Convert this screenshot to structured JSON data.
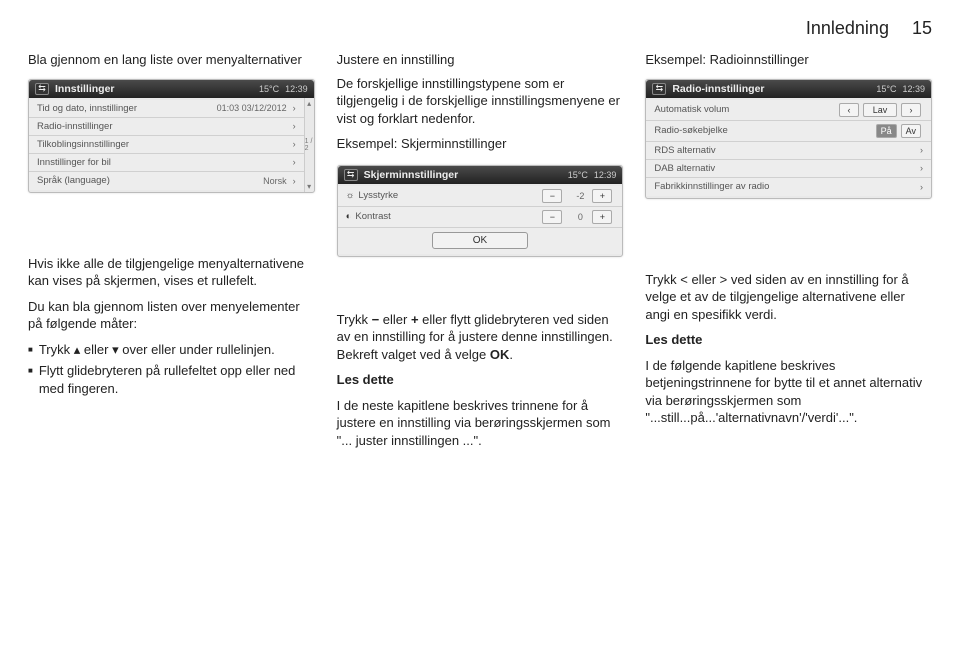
{
  "header": {
    "chapter": "Innledning",
    "page": "15"
  },
  "col1": {
    "heading": "Bla gjennom en lang liste over menyalternativer",
    "device": {
      "back": "⇆",
      "title": "Innstillinger",
      "temp": "15°C",
      "time": "12:39",
      "page_ind": "1 / 2",
      "rows": [
        {
          "label": "Tid og dato, innstillinger",
          "val": "01:03  03/12/2012",
          "chev": "›"
        },
        {
          "label": "Radio-innstillinger",
          "chev": "›"
        },
        {
          "label": "Tilkoblingsinnstillinger",
          "chev": "›"
        },
        {
          "label": "Innstillinger for bil",
          "chev": "›"
        },
        {
          "label": "Språk (language)",
          "val": "Norsk",
          "chev": "›"
        }
      ],
      "scroll_up": "▴",
      "scroll_dn": "▾"
    },
    "p1": "Hvis ikke alle de tilgjengelige menyalternativene kan vises på skjermen, vises et rullefelt.",
    "p2": "Du kan bla gjennom listen over menyelementer på følgende måter:",
    "b1_a": "Trykk ",
    "b1_up": "▴",
    "b1_mid": " eller ",
    "b1_dn": "▾",
    "b1_b": " over eller under rullelinjen.",
    "b2": "Flytt glidebryteren på rullefeltet opp eller ned med fingeren."
  },
  "col2": {
    "heading": "Justere en innstilling",
    "p1": "De forskjellige innstillingstypene som er tilgjengelig i de forskjellige innstillingsmenyene er vist og forklart nedenfor.",
    "p2": "Eksempel: Skjerminnstillinger",
    "device": {
      "back": "⇆",
      "title": "Skjerminnstillinger",
      "temp": "15°C",
      "time": "12:39",
      "row1": {
        "icon": "☼",
        "label": "Lysstyrke",
        "minus": "−",
        "val": "-2",
        "plus": "+"
      },
      "row2": {
        "icon": "◐",
        "label": "Kontrast",
        "minus": "−",
        "val": "0",
        "plus": "+"
      },
      "ok": "OK"
    },
    "p3a": "Trykk ",
    "p3minus": "−",
    "p3b": " eller ",
    "p3plus": "+",
    "p3c": " eller flytt glidebryteren ved siden av en innstilling for å justere denne innstillingen. Bekreft valget ved å velge ",
    "p3ok": "OK",
    "p3d": ".",
    "les": "Les dette",
    "p4": "I de neste kapitlene beskrives trinnene for å justere en innstilling via berøringsskjermen som \"... juster innstillingen ...\"."
  },
  "col3": {
    "heading": "Eksempel: Radioinnstillinger",
    "device": {
      "back": "⇆",
      "title": "Radio-innstillinger",
      "temp": "15°C",
      "time": "12:39",
      "rows": [
        {
          "label": "Automatisk volum",
          "left": "‹",
          "val": "Lav",
          "right": "›"
        },
        {
          "label": "Radio-søkebjelke",
          "on": "På",
          "off": "Av"
        },
        {
          "label": "RDS alternativ",
          "chev": "›"
        },
        {
          "label": "DAB alternativ",
          "chev": "›"
        },
        {
          "label": "Fabrikkinnstillinger av radio",
          "chev": "›"
        }
      ]
    },
    "p1a": "Trykk ",
    "p1lt": "<",
    "p1b": " eller ",
    "p1gt": ">",
    "p1c": " ved siden av en innstilling for å velge et av de tilgjengelige alternativene eller angi en spesifikk verdi.",
    "les": "Les dette",
    "p2": "I de følgende kapitlene beskrives betjeningstrinnene for bytte til et annet alternativ via berøringsskjermen som \"...still...på...'alternativnavn'/'verdi'...\"."
  }
}
